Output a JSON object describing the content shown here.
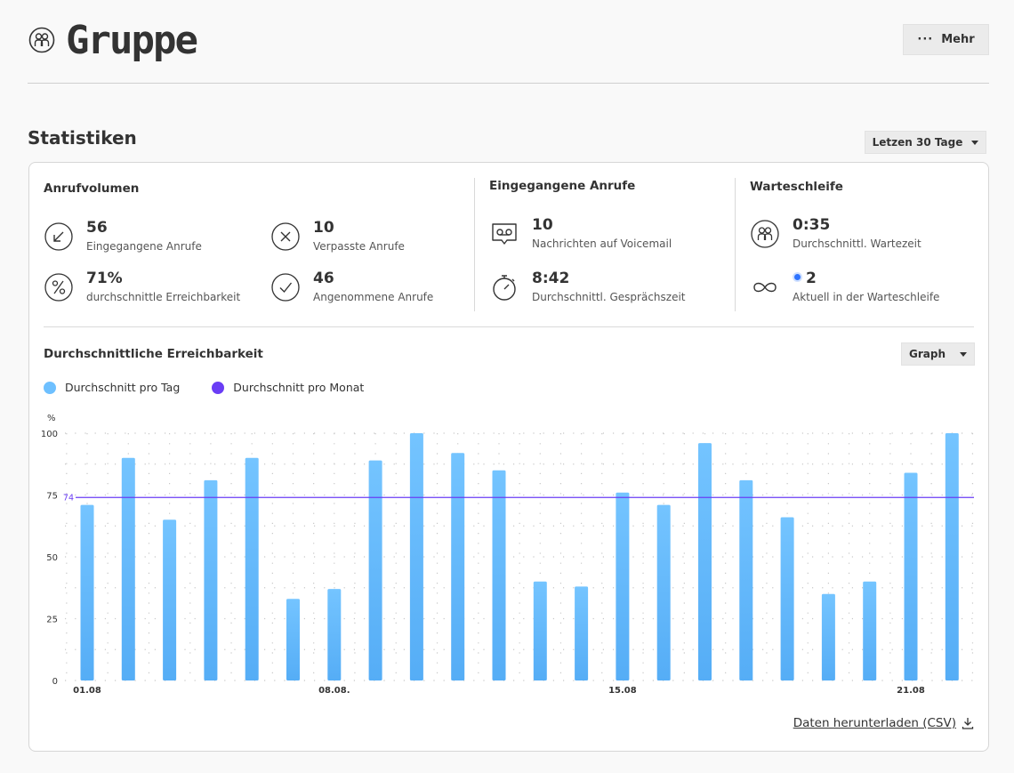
{
  "header": {
    "title": "Gruppe",
    "more_label": "Mehr"
  },
  "section": {
    "title": "Statistiken",
    "range_label": "Letzen 30 Tage"
  },
  "stats": {
    "call_volume": {
      "title": "Anrufvolumen",
      "incoming": {
        "value": "56",
        "label": "Eingegangene Anrufe"
      },
      "missed": {
        "value": "10",
        "label": "Verpasste Anrufe"
      },
      "reachability": {
        "value": "71%",
        "label": "durchschnittle Erreichbarkeit"
      },
      "accepted": {
        "value": "46",
        "label": "Angenommene Anrufe"
      }
    },
    "incoming_calls": {
      "title": "Eingegangene Anrufe",
      "voicemail": {
        "value": "10",
        "label": "Nachrichten auf Voicemail"
      },
      "talk_time": {
        "value": "8:42",
        "label": "Durchschnittl. Gesprächszeit"
      }
    },
    "queue": {
      "title": "Warteschleife",
      "wait_time": {
        "value": "0:35",
        "label": "Durchschnittl. Wartezeit"
      },
      "in_queue": {
        "value": "2",
        "label": "Aktuell in der Warteschleife"
      }
    }
  },
  "chart": {
    "title": "Durchschnittliche Erreichbarkeit",
    "view_label": "Graph",
    "download_label": "Daten herunterladen (CSV)"
  },
  "chart_data": {
    "type": "bar",
    "ylabel": "%",
    "ylim": [
      0,
      100
    ],
    "yticks": [
      0,
      25,
      50,
      75,
      100
    ],
    "x_tick_labels": [
      "01.08",
      "08.08.",
      "15.08",
      "21.08"
    ],
    "x_tick_indices": [
      0,
      6,
      13,
      20
    ],
    "series": [
      {
        "name": "Durchschnitt pro Tag",
        "color": "#6ec0ff",
        "values": [
          71,
          90,
          65,
          81,
          90,
          33,
          37,
          89,
          100,
          92,
          85,
          40,
          38,
          76,
          71,
          96,
          81,
          66,
          35,
          40,
          84,
          100
        ]
      },
      {
        "name": "Durchschnitt pro Monat",
        "color": "#6a3df5",
        "value": 74,
        "label": "74"
      }
    ]
  }
}
